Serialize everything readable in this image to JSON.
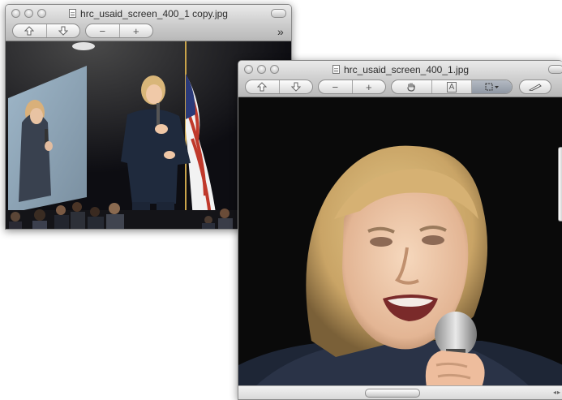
{
  "windows": [
    {
      "title": "hrc_usaid_screen_400_1 copy.jpg"
    },
    {
      "title": "hrc_usaid_screen_400_1.jpg"
    }
  ],
  "toolbar": {
    "minus": "−",
    "plus": "+",
    "overflow": "»",
    "text_tool": "A"
  },
  "icons": {
    "window1": [
      "close-icon",
      "minimize-icon",
      "zoom-icon",
      "document-icon",
      "toolbar-toggle-icon",
      "previous-arrow-icon",
      "next-arrow-icon",
      "zoom-out-icon",
      "zoom-in-icon",
      "overflow-chevron-icon"
    ],
    "window2": [
      "close-icon",
      "minimize-icon",
      "zoom-icon",
      "document-icon",
      "toolbar-toggle-icon",
      "previous-arrow-icon",
      "next-arrow-icon",
      "zoom-out-icon",
      "zoom-in-icon",
      "hand-tool-icon",
      "text-tool-icon",
      "rect-select-icon",
      "annotate-pen-icon"
    ]
  },
  "colors": {
    "selected_segment": "#969eaa",
    "window_chrome": "#d9d9d9",
    "photo_background": "#0a0a0a"
  }
}
